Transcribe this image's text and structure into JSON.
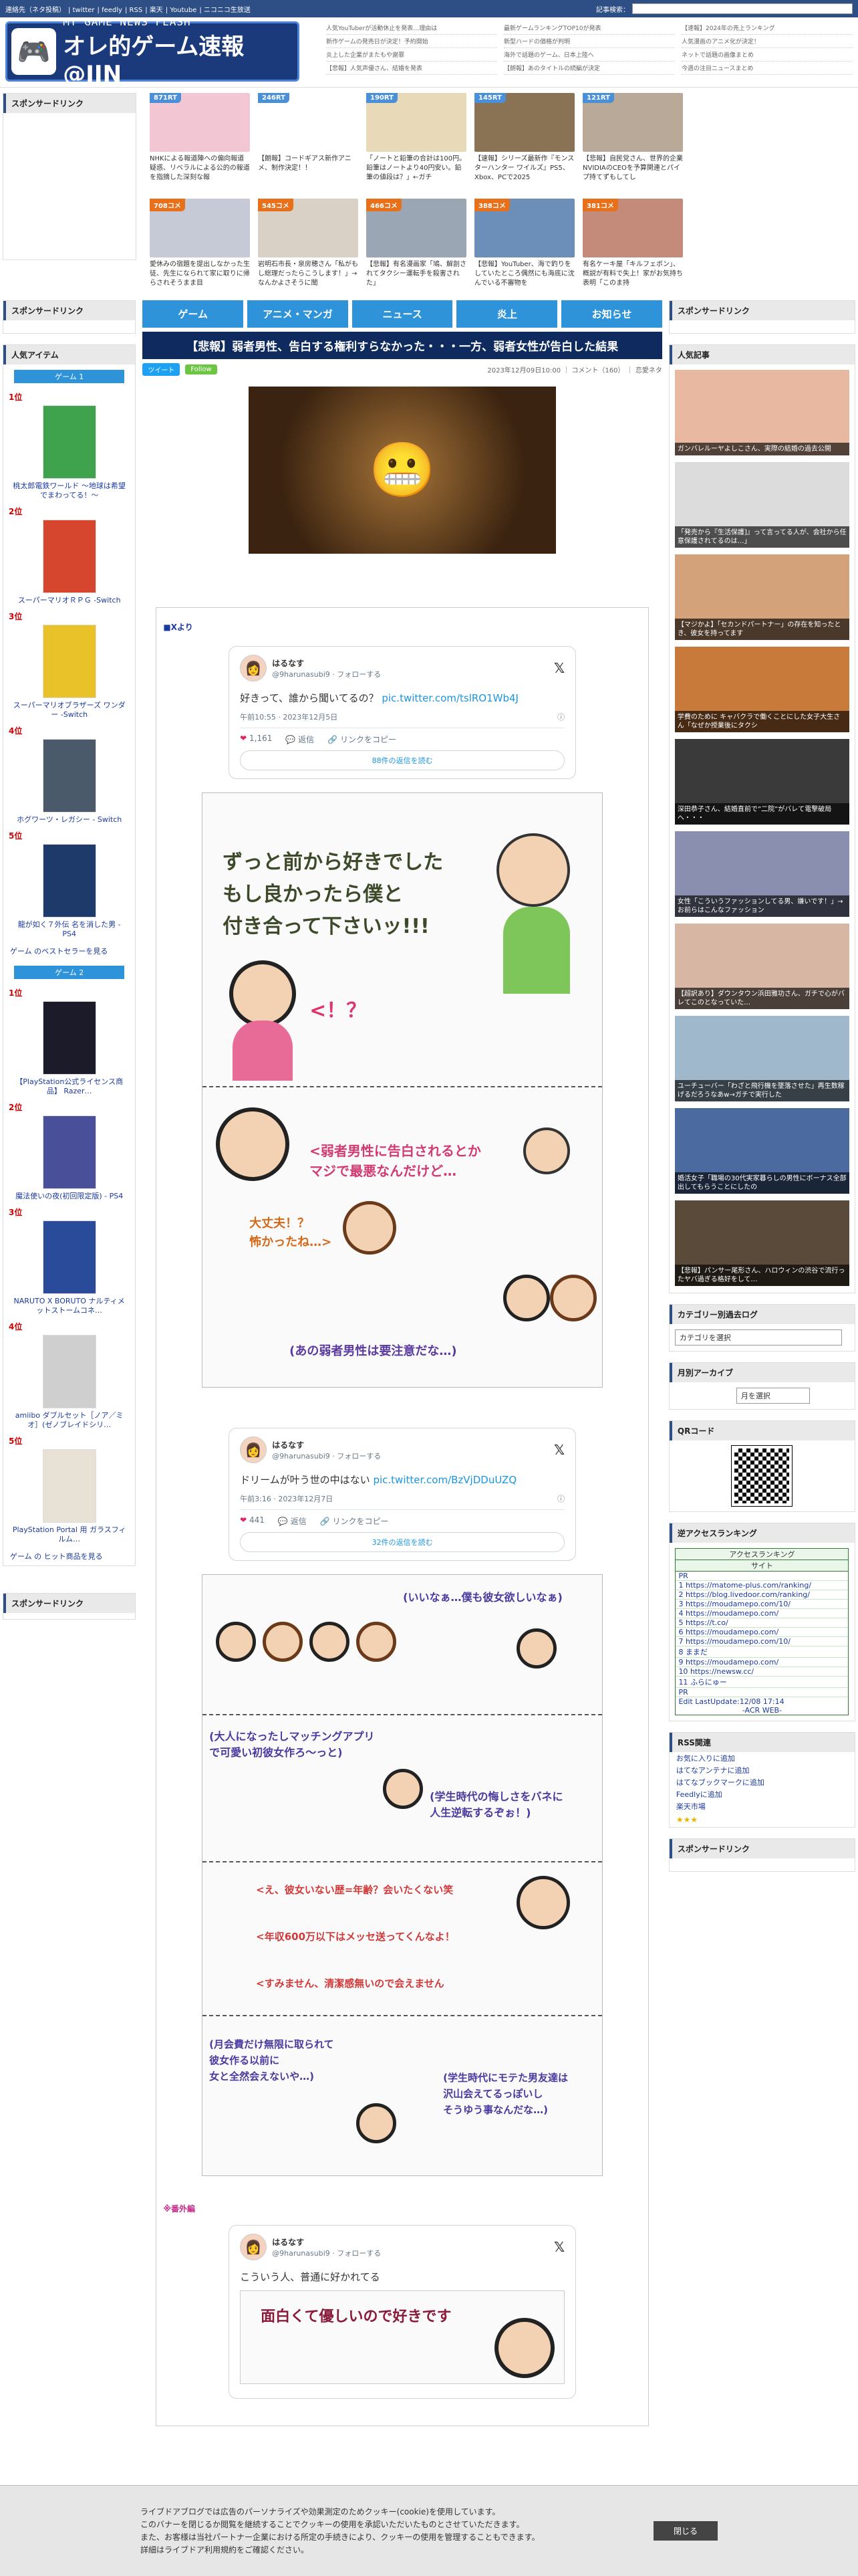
{
  "topbar": {
    "links": [
      "連絡先（ネタ投稿）",
      "twitter",
      "feedly",
      "RSS",
      "楽天",
      "Youtube",
      "ニコニコ生放送"
    ],
    "search_label": "記事検索："
  },
  "logo": {
    "line1": "MY GAME NEWS FLASH",
    "line2": "オレ的ゲーム速報@JIN"
  },
  "headlines": [
    [
      "人気YouTuberが活動休止を発表…理由は",
      "新作ゲームの発売日が決定！予約開始",
      "炎上した企業がまたもや謝罪",
      "【悲報】人気声優さん、結婚を発表"
    ],
    [
      "最新ゲームランキングTOP10が発表",
      "新型ハードの価格が判明",
      "海外で話題のゲーム、日本上陸へ",
      "【朗報】あのタイトルの続編が決定"
    ],
    [
      "【速報】2024年の売上ランキング",
      "人気漫画のアニメ化が決定！",
      "ネットで話題の画像まとめ",
      "今週の注目ニュースまとめ"
    ]
  ],
  "sponsor_label": "スポンサードリンク",
  "thumbs": [
    {
      "badge": "871RT",
      "cap": "NHKによる報道陣への偏向報道疑惑、リベラルによる公的の報道を指摘した深刻な報",
      "color": "#f3c6d4",
      "orange": false
    },
    {
      "badge": "246RT",
      "cap": "【朗報】コードギアス新作アニメ、制作決定！！",
      "color": "#ffffff",
      "orange": false
    },
    {
      "badge": "190RT",
      "cap": "「ノートと鉛筆の合計は100円。鉛筆はノートより40円安い。鉛筆の値段は？」←ガチ",
      "color": "#e8d9b8",
      "orange": false
    },
    {
      "badge": "145RT",
      "cap": "【速報】シリーズ最新作『モンスターハンター ワイルズ』PS5、Xbox、PCで2025",
      "color": "#8a7255",
      "orange": false
    },
    {
      "badge": "121RT",
      "cap": "【悲報】自民党さん、世界的企業NVIDIAのCEOを予算関連とパイプ持てずもしてし",
      "color": "#b8a999",
      "orange": false
    },
    {
      "badge": "708コメ",
      "cap": "愛休みの宿題を提出しなかった生徒、先生になられて家に取りに帰らされそうまま目",
      "color": "#c5cad6",
      "orange": true
    },
    {
      "badge": "545コメ",
      "cap": "岩明石市長・泉房穂さん「私がもし総理だったらこうします！」→なんかよさそうに聞",
      "color": "#d9d0c6",
      "orange": true
    },
    {
      "badge": "466コメ",
      "cap": "【悲報】有名漫画家「鳩、解剖されてタクシー運転手を殺害された」",
      "color": "#9aa6b4",
      "orange": true
    },
    {
      "badge": "388コメ",
      "cap": "【悲報】YouTuber、海で釣りをしていたところ偶然にも海底に沈んでいる不審物を",
      "color": "#6b8fb8",
      "orange": true
    },
    {
      "badge": "381コメ",
      "cap": "有名ケーキ屋「キルフェボン」、概説が有料で失上！家がお気持ち表明「このま持",
      "color": "#c48a7a",
      "orange": true
    }
  ],
  "nav": [
    "ゲーム",
    "アニメ・マンガ",
    "ニュース",
    "炎上",
    "お知らせ"
  ],
  "article": {
    "title": "【悲報】弱者男性、告白する権利すらなかった・・・一方、弱者女性が告白した結果",
    "tweet_btn": "ツイート",
    "follow_btn": "Follow",
    "date": "2023年12月09日10:00 ｜ コメント（160） ｜ 恋愛ネタ",
    "source": "■Xより",
    "tweets": [
      {
        "name": "はるなす",
        "handle": "@9harunasubi9 · フォローする",
        "text": "好きって、誰から聞いてるの？",
        "link": "pic.twitter.com/tslRO1Wb4J",
        "time": "午前10:55 · 2023年12月5日",
        "likes": "1,161",
        "reply": "返信",
        "copy": "リンクをコピー",
        "more": "88件の返信を読む"
      },
      {
        "name": "はるなす",
        "handle": "@9harunasubi9 · フォローする",
        "text": "ドリームが叶う世の中はない",
        "link": "pic.twitter.com/BzVjDDuUZQ",
        "time": "午前3:16 · 2023年12月7日",
        "likes": "441",
        "reply": "返信",
        "copy": "リンクをコピー",
        "more": "32件の返信を読む"
      },
      {
        "name": "はるなす",
        "handle": "@9harunasubi9 · フォローする",
        "text": "こういう人、普通に好かれてる",
        "link": "",
        "time": "",
        "likes": "",
        "reply": "",
        "copy": "",
        "more": ""
      }
    ],
    "comic1": {
      "p1": "ずっと前から好きでした\nもし良かったら僕と\n付き合って下さいッ!!!",
      "p1b": "<！？",
      "p2": "<弱者男性に告白されるとか\nマジで最悪なんだけど…",
      "p2b": "大丈夫！？\n怖かったね…>",
      "p2c": "(あの弱者男性は要注意だな…)"
    },
    "comic2": {
      "p1": "(いいなぁ…僕も彼女欲しいなぁ)",
      "p2": "(大人になったしマッチングアプリ\nで可愛い初彼女作ろ〜っと)",
      "p2b": "(学生時代の悔しさをバネに\n人生逆転するぞぉ！)",
      "p3a": "<え、彼女いない歴=年齢？会いたくない笑",
      "p3b": "<年収600万以下はメッセ送ってくんなよ！",
      "p3c": "<すみません、清潔感無いので会えません",
      "p4": "(月会費だけ無限に取られて\n彼女作る以前に\n女と全然会えないや…)",
      "p4b": "(学生時代にモテた男友達は\n沢山会えてるっぽいし\nそうゆう事なんだな…)"
    },
    "extra": "※番外編",
    "comic3_text": "面白くて優しいので好きです"
  },
  "left": {
    "popular": "人気アイテム",
    "tab1": "ゲーム 1",
    "tab2": "ゲーム 2",
    "list1": [
      {
        "no": "1位",
        "name": "桃太郎電鉄ワールド ～地球は希望でまわってる！～",
        "color": "#3fa34d"
      },
      {
        "no": "2位",
        "name": "スーパーマリオＲＰＧ -Switch",
        "color": "#d6452e"
      },
      {
        "no": "3位",
        "name": "スーパーマリオブラザーズ ワンダー -Switch",
        "color": "#e8c228"
      },
      {
        "no": "4位",
        "name": "ホグワーツ・レガシー - Switch",
        "color": "#4b5a6a"
      },
      {
        "no": "5位",
        "name": "龍が如く７外伝 名を消した男 - PS4",
        "color": "#1e3a6a"
      }
    ],
    "more1": "ゲーム のベストセラーを見る",
    "list2": [
      {
        "no": "1位",
        "name": "【PlayStation公式ライセンス商品】 Razer…",
        "color": "#1b1b2a"
      },
      {
        "no": "2位",
        "name": "魔法使いの夜(初回限定版) - PS4",
        "color": "#4a4f9a"
      },
      {
        "no": "3位",
        "name": "NARUTO X BORUTO ナルティメットストームコネ…",
        "color": "#2a4a9a"
      },
      {
        "no": "4位",
        "name": "amiibo ダブルセット［ノア／ミオ］(ゼノブレイドシリ…",
        "color": "#cfcfcf"
      },
      {
        "no": "5位",
        "name": "PlayStation Portal 用 ガラスフィルム…",
        "color": "#e8e2d6"
      }
    ],
    "more2": "ゲーム の ヒット商品を見る"
  },
  "right": {
    "popular": "人気記事",
    "pops": [
      {
        "cap": "ガンバレルーヤよしこさん、実際の結婚の過去公開",
        "color": "#e8b9a0"
      },
      {
        "cap": "「発売から『生活保護]』って言ってる人が、会社から任意保護されてるのは…」",
        "color": "#dcdcdc"
      },
      {
        "cap": "【マジかよ】「セカンドパートナー」の存在を知ったとき、彼女を持ってます",
        "color": "#d4a27a"
      },
      {
        "cap": "学費のために キャバクラで働くことにした女子大生さん「なぜか授業後にタクシ",
        "color": "#c87a3a"
      },
      {
        "cap": "深田恭子さん、結婚直前で”二院”がバレて電撃破局へ・・・",
        "color": "#3a3a3a"
      },
      {
        "cap": "女性「こういうファッションしてる男、嫌いです！」→お前らはこんなファッション",
        "color": "#8a8fb0"
      },
      {
        "cap": "【超訳あり】ダウンタウン浜田雅功さん、ガチで心がバレてこのとなっていた…",
        "color": "#d7b7a4"
      },
      {
        "cap": "ユーチューバー「わざと飛行機を墜落させた」再生数稼げるだろうなあw→ガチで実行した",
        "color": "#9fb8cc"
      },
      {
        "cap": "婚活女子「職場の30代実家暮らしの男性にボーナス全部出してもらうことにしたの",
        "color": "#4a6aa0"
      },
      {
        "cap": "【悲報】パンサー尾形さん、ハロウィンの渋谷で流行ったヤバ過ぎる格好をして…",
        "color": "#5a4a3a"
      }
    ],
    "catlog": "カテゴリー別過去ログ",
    "cat_sel": "カテゴリを選択",
    "monthly": "月別アーカイブ",
    "month_sel": "月を選択",
    "qr": "QRコード",
    "rev": "逆アクセスランキング",
    "acr_title": "アクセスランキング",
    "acr_site": "サイト",
    "acr_items": [
      "PR",
      "https://matome-plus.com/ranking/",
      "https://blog.livedoor.com/ranking/",
      "https://moudamepo.com/10/",
      "https://moudamepo.com/",
      "https://t.co/",
      "https://moudamepo.com/",
      "https://moudamepo.com/10/",
      "ままだ",
      "https://moudamepo.com/",
      "https://newsw.cc/",
      "ふらにゅー",
      "PR"
    ],
    "acr_foot": "Edit LastUpdate:12/08 17:14",
    "acr_web": "-ACR WEB-",
    "rss": "RSS関連",
    "rss_links": [
      "お気に入りに追加",
      "はてなアンテナに追加",
      "はてなブックマークに追加",
      "Feedlyに追加",
      "楽天市場"
    ],
    "sponsor": "スポンサードリンク"
  },
  "cookie": {
    "text": "ライブドアブログでは広告のパーソナライズや効果測定のためクッキー(cookie)を使用しています。\nこのバナーを閉じるか閲覧を継続することでクッキーの使用を承認いただいたものとさせていただきます。\nまた、お客様は当社パートナー企業における所定の手続きにより、クッキーの使用を管理することもできます。\n詳細はライブドア利用規約をご確認ください。",
    "close": "閉じる"
  }
}
